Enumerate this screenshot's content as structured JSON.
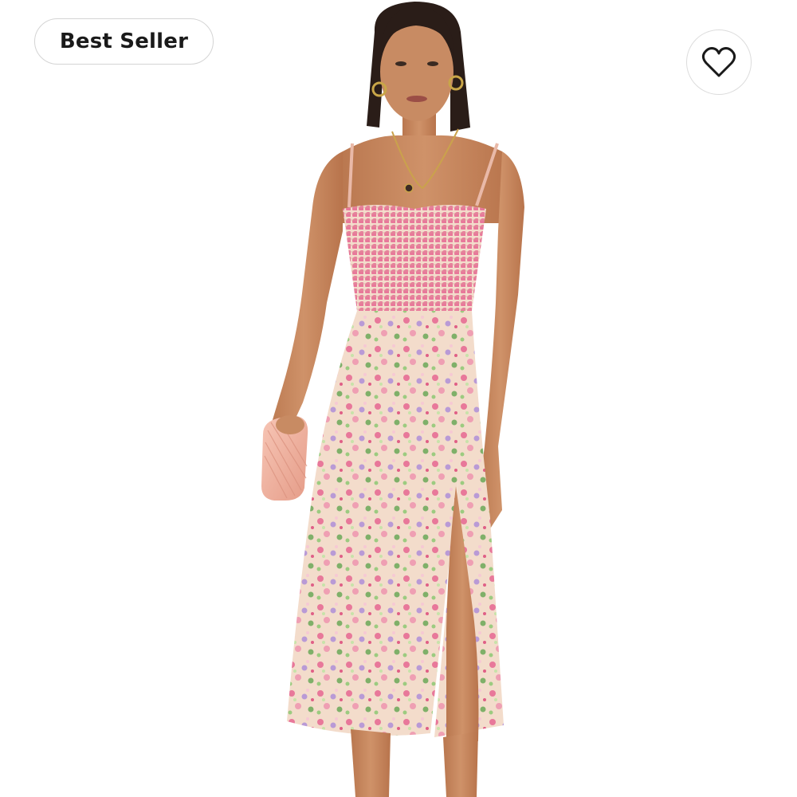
{
  "badge": {
    "label": "Best Seller"
  },
  "favorite": {
    "icon": "heart-icon"
  },
  "product": {
    "image_description_icon": "model-wearing-floral-midi-dress"
  },
  "colors": {
    "background": "#ffffff",
    "badge_border": "#d4d4d4",
    "text": "#1a1a1a",
    "dress_base": "#f2d9c8",
    "dress_pink": "#e8789a",
    "dress_green": "#7fb069",
    "dress_lilac": "#b99ad6",
    "skin": "#c98a63",
    "hair": "#2a1d18",
    "clutch": "#f0b3a3"
  }
}
